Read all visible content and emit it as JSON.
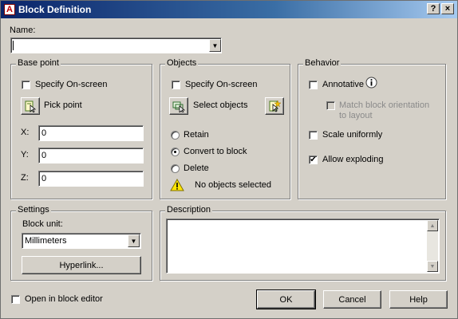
{
  "window": {
    "title": "Block Definition",
    "help_glyph": "?",
    "close_glyph": "×"
  },
  "name": {
    "label": "Name:",
    "value": ""
  },
  "base_point": {
    "title": "Base point",
    "specify_onscreen": {
      "label": "Specify On-screen",
      "checked": false
    },
    "pick_point_label": "Pick point",
    "x_label": "X:",
    "x_value": "0",
    "y_label": "Y:",
    "y_value": "0",
    "z_label": "Z:",
    "z_value": "0"
  },
  "objects": {
    "title": "Objects",
    "specify_onscreen": {
      "label": "Specify On-screen",
      "checked": false
    },
    "select_objects_label": "Select objects",
    "options": [
      {
        "label": "Retain",
        "selected": false
      },
      {
        "label": "Convert to block",
        "selected": true
      },
      {
        "label": "Delete",
        "selected": false
      }
    ],
    "status": "No objects selected"
  },
  "behavior": {
    "title": "Behavior",
    "annotative": {
      "label": "Annotative",
      "checked": false
    },
    "match_orientation": {
      "label_line1": "Match block orientation",
      "label_line2": "to layout",
      "checked": false,
      "enabled": false
    },
    "scale_uniformly": {
      "label": "Scale uniformly",
      "checked": false
    },
    "allow_exploding": {
      "label": "Allow exploding",
      "checked": true
    }
  },
  "settings": {
    "title": "Settings",
    "block_unit_label": "Block unit:",
    "block_unit_value": "Millimeters",
    "hyperlink_label": "Hyperlink..."
  },
  "description": {
    "title": "Description",
    "value": ""
  },
  "footer": {
    "open_in_editor": {
      "label": "Open in block editor",
      "checked": false
    },
    "ok_label": "OK",
    "cancel_label": "Cancel",
    "help_label": "Help"
  },
  "icons": {
    "checkmark": "✔",
    "dropdown": "▼",
    "scroll_up": "▲",
    "scroll_down": "▼"
  }
}
